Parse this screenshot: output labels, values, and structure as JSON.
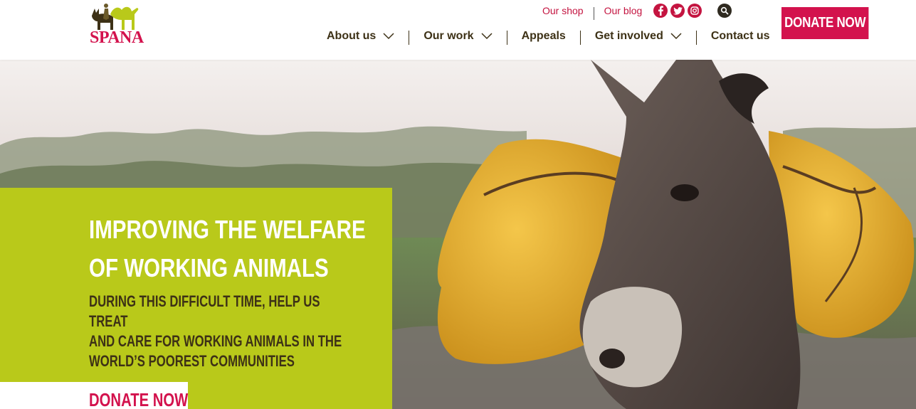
{
  "brand": {
    "name": "SPANA",
    "accent": "#d3124d",
    "green": "#b9c91a",
    "dark": "#3d3116"
  },
  "top_links": {
    "shop": "Our shop",
    "blog": "Our blog",
    "social": [
      "facebook-icon",
      "twitter-icon",
      "instagram-icon"
    ],
    "search": "search-icon"
  },
  "nav": {
    "items": [
      {
        "label": "About us",
        "dropdown": true
      },
      {
        "label": "Our work",
        "dropdown": true
      },
      {
        "label": "Appeals",
        "dropdown": false
      },
      {
        "label": "Get involved",
        "dropdown": true
      },
      {
        "label": "Contact us",
        "dropdown": false
      }
    ]
  },
  "donate_top": "DONATE NOW",
  "hero": {
    "title_line1": "IMPROVING THE WELFARE",
    "title_line2": "OF WORKING ANIMALS",
    "sub_line1": "DURING THIS DIFFICULT TIME, HELP US TREAT",
    "sub_line2": "AND CARE FOR WORKING ANIMALS IN THE",
    "sub_line3": "WORLD’S POOREST COMMUNITIES",
    "donate_label": "DONATE NOW",
    "image": "donkey carrying yellow water containers"
  }
}
